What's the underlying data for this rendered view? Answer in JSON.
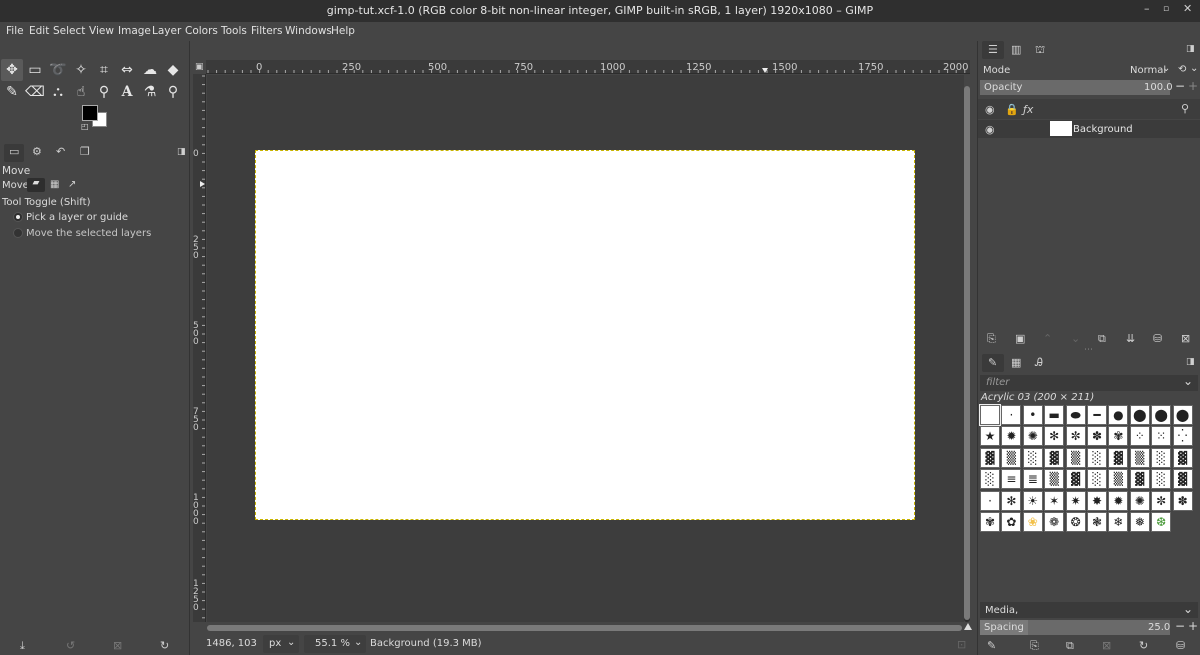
{
  "window": {
    "title": "gimp-tut.xcf-1.0 (RGB color 8-bit non-linear integer, GIMP built-in sRGB, 1 layer) 1920x1080 – GIMP",
    "controls": [
      "–",
      "▫",
      "✕"
    ]
  },
  "menu": [
    "File",
    "Edit",
    "Select",
    "View",
    "Image",
    "Layer",
    "Colors",
    "Tools",
    "Filters",
    "Windows",
    "Help"
  ],
  "toolbox": {
    "tool_icons": [
      "move-icon",
      "rect-select-icon",
      "lasso-icon",
      "fuzzy-select-icon",
      "crop-icon",
      "transform-icon",
      "warp-icon",
      "bucket-fill-icon",
      "paintbrush-icon",
      "eraser-icon",
      "clone-icon",
      "smudge-icon",
      "paths-icon",
      "text-icon",
      "color-picker-icon",
      "zoom-icon"
    ],
    "fg_color": "#000000",
    "bg_color": "#ffffff"
  },
  "tool_options": {
    "title": "Move",
    "move_label": "Move:",
    "toggle_label": "Tool Toggle  (Shift)",
    "options": [
      "Pick a layer or guide",
      "Move the selected layers"
    ],
    "selected_option": 0
  },
  "ruler": {
    "h_labels": [
      "0",
      "250",
      "500",
      "750",
      "1000",
      "1250",
      "1500",
      "1750",
      "2000"
    ],
    "v_labels": [
      "0",
      "250",
      "500",
      "750",
      "1000",
      "1250"
    ]
  },
  "status": {
    "coords": "1486, 103",
    "unit": "px",
    "zoom": "55.1 %",
    "info": "Background (19.3 MB)"
  },
  "layers": {
    "mode_label": "Mode",
    "mode_value": "Normal",
    "opacity_label": "Opacity",
    "opacity_value": "100.0",
    "layer_name": "Background"
  },
  "brushes": {
    "filter_placeholder": "filter",
    "selected_brush": "Acrylic 03 (200 × 211)",
    "preset": "Media,",
    "spacing_label": "Spacing",
    "spacing_value": "25.0"
  },
  "colors": {
    "selection_dash": "#c8b400",
    "accent": "#6a6a6a"
  }
}
